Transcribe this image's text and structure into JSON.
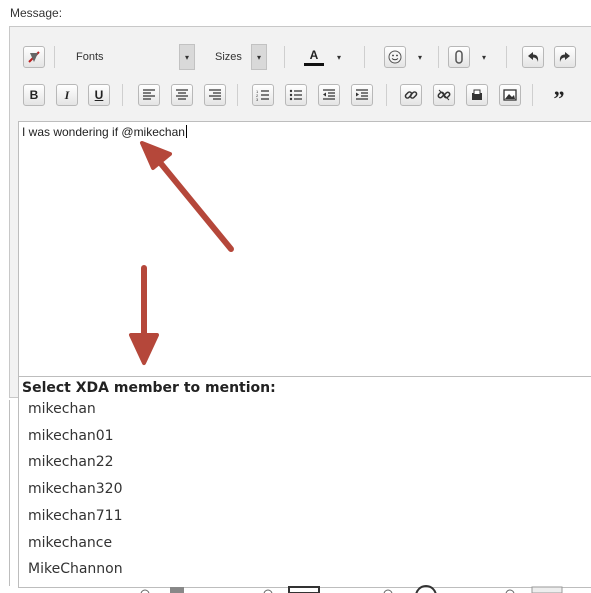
{
  "form": {
    "message_label": "Message:"
  },
  "toolbar": {
    "fonts_label": "Fonts",
    "sizes_label": "Sizes",
    "text_color_glyph": "A",
    "bold_glyph": "B",
    "italic_glyph": "I",
    "underline_glyph": "U",
    "quote_glyph": "”",
    "icons": [
      "remove-format-icon",
      "text-color-icon",
      "smiley-icon",
      "attachment-icon",
      "undo-icon",
      "redo-icon",
      "bold-icon",
      "italic-icon",
      "underline-icon",
      "align-left-icon",
      "align-center-icon",
      "align-right-icon",
      "ordered-list-icon",
      "unordered-list-icon",
      "outdent-icon",
      "indent-icon",
      "link-icon",
      "unlink-icon",
      "email-icon",
      "image-icon",
      "quote-icon"
    ]
  },
  "editor": {
    "text": "I was wondering if @mikechan"
  },
  "mention_popup": {
    "title": "Select XDA member to mention:",
    "items": [
      "mikechan",
      "mikechan01",
      "mikechan22",
      "mikechan320",
      "mikechan711",
      "mikechance",
      "MikeChannon"
    ]
  },
  "annotations": {
    "arrow_color": "#b5473a"
  }
}
